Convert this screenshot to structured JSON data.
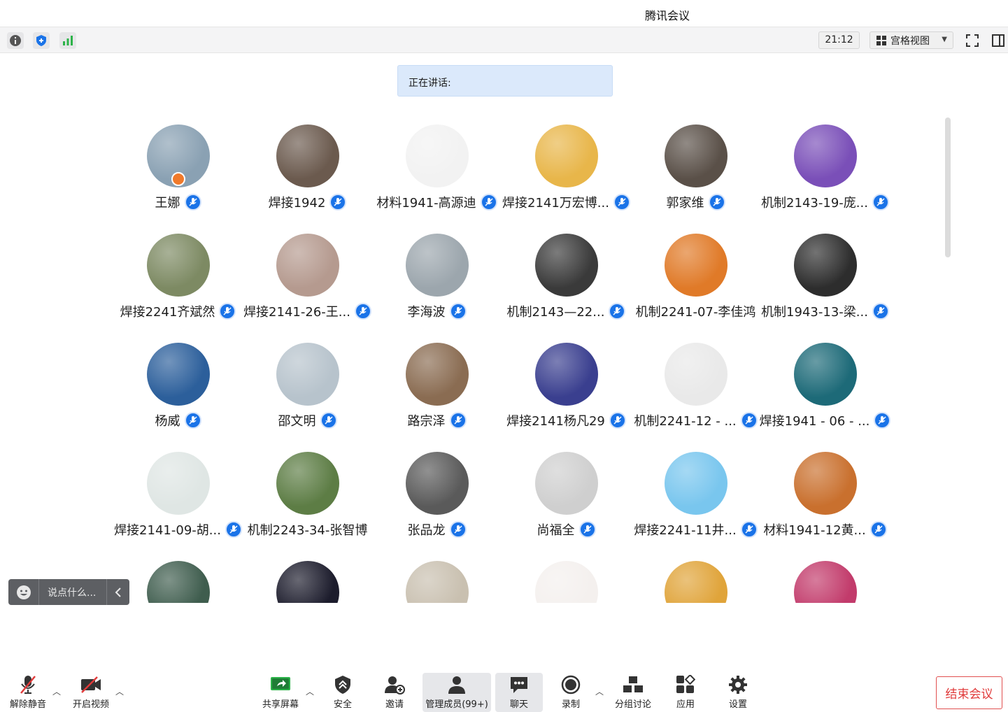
{
  "window": {
    "title": "腾讯会议"
  },
  "topbar": {
    "time": "21:12",
    "view_label": "宫格视图"
  },
  "speaking": {
    "label": "正在讲话:"
  },
  "participants": [
    {
      "name": "王娜",
      "color": "#8aa1b3",
      "host": true,
      "mic": true
    },
    {
      "name": "焊接1942",
      "color": "#6b5a4e",
      "mic": true
    },
    {
      "name": "材料1941-高源迪",
      "color": "#f2f2f2",
      "mic": true
    },
    {
      "name": "焊接2141万宏博...",
      "color": "#e8b64a",
      "mic": true
    },
    {
      "name": "郭家维",
      "color": "#5a5048",
      "mic": true
    },
    {
      "name": "机制2143-19-庞...",
      "color": "#7a4fb8",
      "mic": true
    },
    {
      "name": "焊接2241齐斌然",
      "color": "#7d8a63",
      "mic": true
    },
    {
      "name": "焊接2141-26-王...",
      "color": "#b59a8f",
      "mic": true
    },
    {
      "name": "李海波",
      "color": "#9ca6ad",
      "mic": true
    },
    {
      "name": "机制2143—22...",
      "color": "#3a3a3a",
      "mic": true
    },
    {
      "name": "机制2241-07-李佳鸿",
      "color": "#e07a28",
      "mic": false
    },
    {
      "name": "机制1943-13-梁...",
      "color": "#2d2d2d",
      "mic": true
    },
    {
      "name": "杨威",
      "color": "#2c5f9b",
      "mic": true
    },
    {
      "name": "邵文明",
      "color": "#b7c3cc",
      "mic": true
    },
    {
      "name": "路宗泽",
      "color": "#8a6c52",
      "mic": true
    },
    {
      "name": "焊接2141杨凡29",
      "color": "#3a3f8f",
      "mic": true
    },
    {
      "name": "机制2241-12 - ...",
      "color": "#e9e9e9",
      "mic": true
    },
    {
      "name": "焊接1941 - 06 - ...",
      "color": "#1d6a78",
      "mic": true
    },
    {
      "name": "焊接2141-09-胡...",
      "color": "#dfe6e4",
      "mic": true
    },
    {
      "name": "机制2243-34-张智博",
      "color": "#5d7d45",
      "mic": false
    },
    {
      "name": "张品龙",
      "color": "#5a5a5a",
      "mic": true
    },
    {
      "name": "尚福全",
      "color": "#cfcfcf",
      "mic": true
    },
    {
      "name": "焊接2241-11井...",
      "color": "#79c6ee",
      "mic": true
    },
    {
      "name": "材料1941-12黄...",
      "color": "#c9702e",
      "mic": true
    },
    {
      "name": "",
      "color": "#3f5d4e",
      "mic": false
    },
    {
      "name": "",
      "color": "#1c1c2c",
      "mic": false
    },
    {
      "name": "",
      "color": "#c9c0b0",
      "mic": false
    },
    {
      "name": "",
      "color": "#f4f0ee",
      "mic": false
    },
    {
      "name": "",
      "color": "#e0a43a",
      "mic": false
    },
    {
      "name": "",
      "color": "#c23b6b",
      "mic": false
    }
  ],
  "chat": {
    "placeholder": "说点什么..."
  },
  "toolbar": {
    "unmute": "解除静音",
    "start_video": "开启视频",
    "share_screen": "共享屏幕",
    "security": "安全",
    "invite": "邀请",
    "manage_members": "管理成员(99+)",
    "chat": "聊天",
    "record": "录制",
    "breakout": "分组讨论",
    "apps": "应用",
    "settings": "设置",
    "end_meeting": "结束会议"
  },
  "colors": {
    "accent": "#1a73e8",
    "danger": "#e03a3a",
    "speaking_bg": "#dbe9fb"
  }
}
